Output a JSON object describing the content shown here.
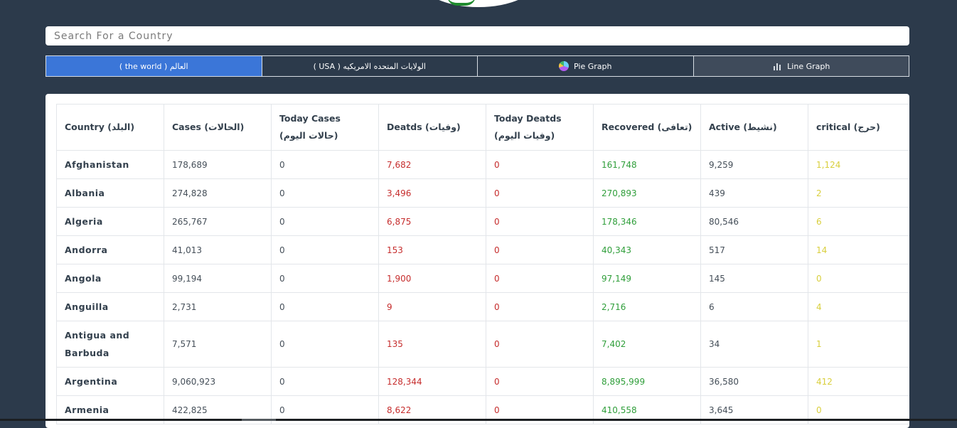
{
  "search": {
    "placeholder": "Search For a Country",
    "value": ""
  },
  "tabs": [
    {
      "label": "العالم ( the world )",
      "active": true,
      "icon": ""
    },
    {
      "label": "الولايات المتحده الامريكيه ( USA )",
      "active": false,
      "icon": ""
    },
    {
      "label": "Pie Graph",
      "active": false,
      "icon": "pie-chart-icon"
    },
    {
      "label": "Line Graph",
      "active": false,
      "icon": "line-chart-icon"
    }
  ],
  "table": {
    "headers": [
      {
        "line1": "Country (البلد)",
        "line2": ""
      },
      {
        "line1": "Cases (الحالات)",
        "line2": ""
      },
      {
        "line1": "Today Cases",
        "line2": "(حالات اليوم)"
      },
      {
        "line1": "Deatds (وفيات)",
        "line2": ""
      },
      {
        "line1": "Today Deatds",
        "line2": "(وفيات اليوم)"
      },
      {
        "line1": "Recovered (تعافى)",
        "line2": ""
      },
      {
        "line1": "Active (نشيط)",
        "line2": ""
      },
      {
        "line1": "critical (حرج)",
        "line2": ""
      }
    ],
    "rows": [
      {
        "country": "Afghanistan",
        "cases": "178,689",
        "today_cases": "0",
        "deaths": "7,682",
        "today_deaths": "0",
        "recovered": "161,748",
        "active": "9,259",
        "critical": "1,124"
      },
      {
        "country": "Albania",
        "cases": "274,828",
        "today_cases": "0",
        "deaths": "3,496",
        "today_deaths": "0",
        "recovered": "270,893",
        "active": "439",
        "critical": "2"
      },
      {
        "country": "Algeria",
        "cases": "265,767",
        "today_cases": "0",
        "deaths": "6,875",
        "today_deaths": "0",
        "recovered": "178,346",
        "active": "80,546",
        "critical": "6"
      },
      {
        "country": "Andorra",
        "cases": "41,013",
        "today_cases": "0",
        "deaths": "153",
        "today_deaths": "0",
        "recovered": "40,343",
        "active": "517",
        "critical": "14"
      },
      {
        "country": "Angola",
        "cases": "99,194",
        "today_cases": "0",
        "deaths": "1,900",
        "today_deaths": "0",
        "recovered": "97,149",
        "active": "145",
        "critical": "0"
      },
      {
        "country": "Anguilla",
        "cases": "2,731",
        "today_cases": "0",
        "deaths": "9",
        "today_deaths": "0",
        "recovered": "2,716",
        "active": "6",
        "critical": "4"
      },
      {
        "country": "Antigua and Barbuda",
        "cases": "7,571",
        "today_cases": "0",
        "deaths": "135",
        "today_deaths": "0",
        "recovered": "7,402",
        "active": "34",
        "critical": "1"
      },
      {
        "country": "Argentina",
        "cases": "9,060,923",
        "today_cases": "0",
        "deaths": "128,344",
        "today_deaths": "0",
        "recovered": "8,895,999",
        "active": "36,580",
        "critical": "412"
      },
      {
        "country": "Armenia",
        "cases": "422,825",
        "today_cases": "0",
        "deaths": "8,622",
        "today_deaths": "0",
        "recovered": "410,558",
        "active": "3,645",
        "critical": "0"
      }
    ]
  }
}
